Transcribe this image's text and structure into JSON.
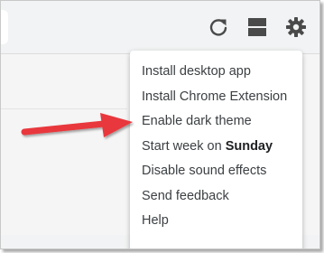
{
  "toolbar": {
    "icons": [
      "refresh-icon",
      "layout-icon",
      "gear-icon"
    ],
    "icon_color": "#4a4a4a"
  },
  "menu": {
    "items": [
      {
        "label": "Install desktop app"
      },
      {
        "label": "Install Chrome Extension"
      },
      {
        "label": "Enable dark theme"
      },
      {
        "label": "Start week on ",
        "bold": "Sunday"
      },
      {
        "label": "Disable sound effects"
      },
      {
        "label": "Send feedback"
      },
      {
        "label": "Help"
      }
    ]
  },
  "annotation": {
    "arrow_color": "#e8383c",
    "points_to": "Enable dark theme"
  }
}
